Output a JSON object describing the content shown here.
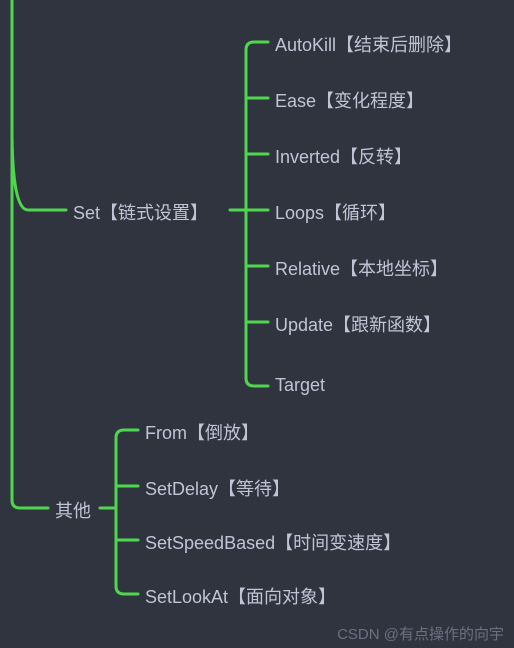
{
  "nodes": {
    "set": "Set【链式设置】",
    "set_children": {
      "autokill": "AutoKill【结束后删除】",
      "ease": "Ease【变化程度】",
      "inverted": "Inverted【反转】",
      "loops": "Loops【循环】",
      "relative": "Relative【本地坐标】",
      "update": "Update【跟新函数】",
      "target": "Target"
    },
    "other": "其他",
    "other_children": {
      "from": "From【倒放】",
      "setdelay": "SetDelay【等待】",
      "setspeedbased": "SetSpeedBased【时间变速度】",
      "setlookat": "SetLookAt【面向对象】"
    }
  },
  "watermark": "CSDN @有点操作的向宇",
  "colors": {
    "bg": "#30343f",
    "text": "#bfc5d6",
    "line": "#4fd64f"
  }
}
